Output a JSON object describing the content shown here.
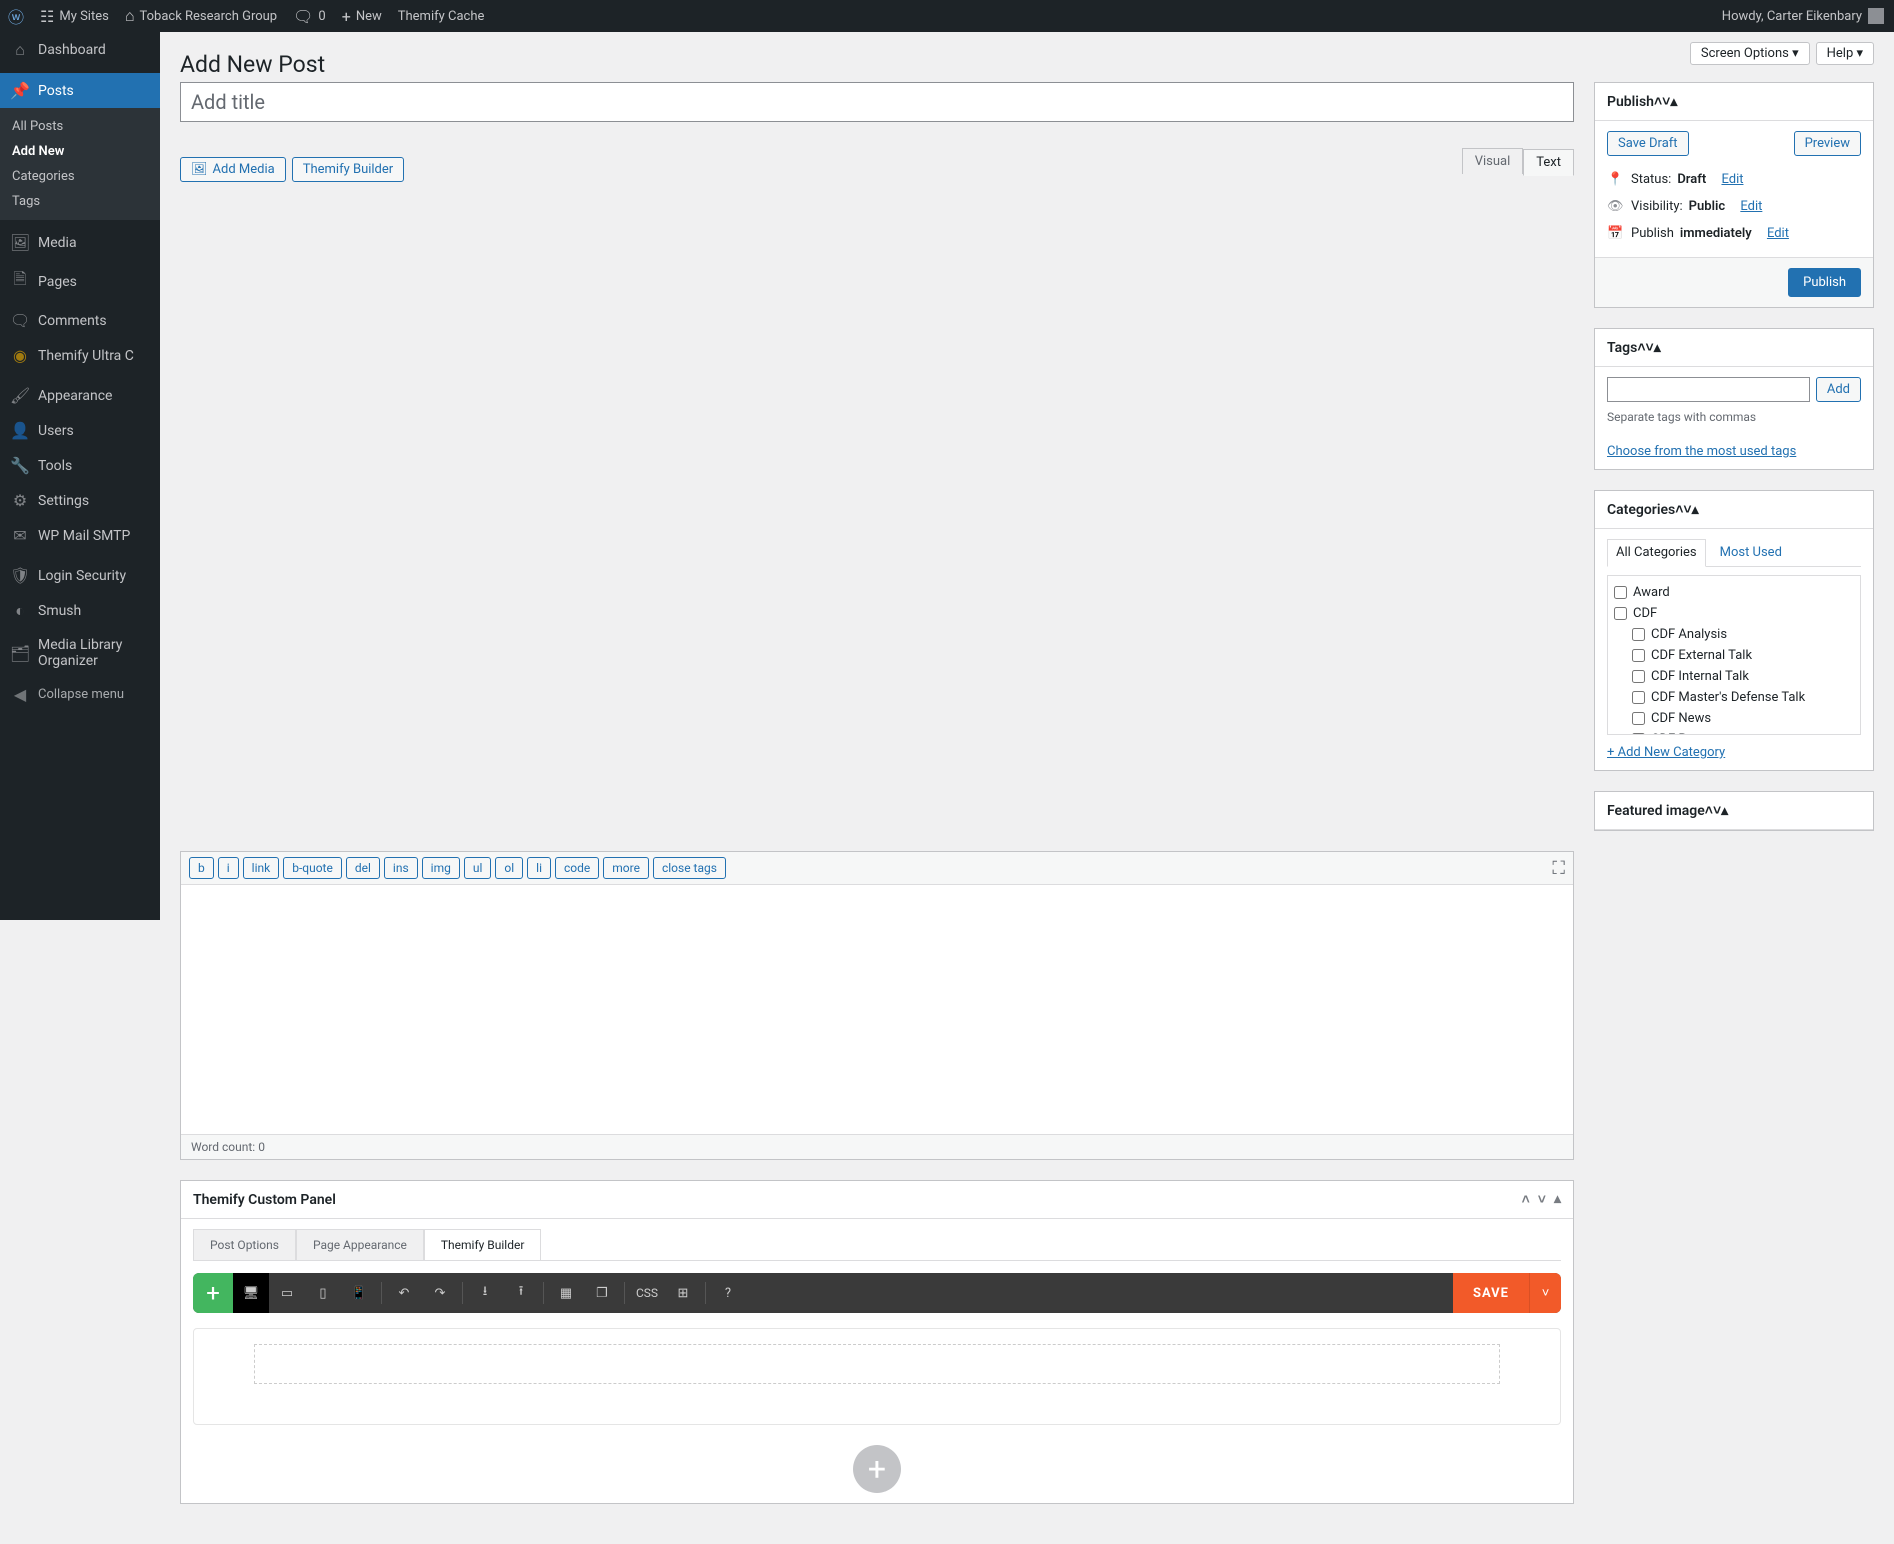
{
  "adminbar": {
    "mysites": "My Sites",
    "site_name": "Toback Research Group",
    "comments": "0",
    "new": "New",
    "themify_cache": "Themify Cache",
    "howdy": "Howdy, Carter Eikenbary"
  },
  "sidebar": {
    "dashboard": "Dashboard",
    "posts": "Posts",
    "submenu": {
      "all": "All Posts",
      "add": "Add New",
      "cat": "Categories",
      "tags": "Tags"
    },
    "media": "Media",
    "pages": "Pages",
    "comments": "Comments",
    "themify_ultra": "Themify Ultra C",
    "appearance": "Appearance",
    "users": "Users",
    "tools": "Tools",
    "settings": "Settings",
    "wp_mail": "WP Mail SMTP",
    "login_sec": "Login Security",
    "smush": "Smush",
    "media_lib": "Media Library Organizer",
    "collapse": "Collapse menu"
  },
  "top_tabs": {
    "screen_options": "Screen Options ▾",
    "help": "Help ▾"
  },
  "page": {
    "heading": "Add New Post",
    "title_placeholder": "Add title",
    "add_media": "Add Media",
    "themify_builder": "Themify Builder",
    "tab_visual": "Visual",
    "tab_text": "Text",
    "word_count_label": "Word count: ",
    "word_count": "0"
  },
  "quicktags": [
    "b",
    "i",
    "link",
    "b-quote",
    "del",
    "ins",
    "img",
    "ul",
    "ol",
    "li",
    "code",
    "more",
    "close tags"
  ],
  "themify_panel": {
    "title": "Themify Custom Panel",
    "tabs": {
      "post_options": "Post Options",
      "page_appearance": "Page Appearance",
      "builder": "Themify Builder"
    },
    "css": "CSS",
    "save": "SAVE"
  },
  "publish": {
    "title": "Publish",
    "save_draft": "Save Draft",
    "preview": "Preview",
    "status_label": "Status: ",
    "status_value": "Draft",
    "visibility_label": "Visibility: ",
    "visibility_value": "Public",
    "publish_label": "Publish ",
    "publish_value": "immediately",
    "edit": "Edit",
    "publish_btn": "Publish"
  },
  "tags": {
    "title": "Tags",
    "add": "Add",
    "help": "Separate tags with commas",
    "choose": "Choose from the most used tags"
  },
  "categories": {
    "title": "Categories",
    "tab_all": "All Categories",
    "tab_used": "Most Used",
    "items": [
      {
        "label": "Award",
        "child": false
      },
      {
        "label": "CDF",
        "child": false
      },
      {
        "label": "CDF Analysis",
        "child": true
      },
      {
        "label": "CDF External Talk",
        "child": true
      },
      {
        "label": "CDF Internal Talk",
        "child": true
      },
      {
        "label": "CDF Master's Defense Talk",
        "child": true
      },
      {
        "label": "CDF News",
        "child": true
      },
      {
        "label": "CDF Paper",
        "child": true
      }
    ],
    "add_new": "+ Add New Category"
  },
  "featured": {
    "title": "Featured image"
  }
}
